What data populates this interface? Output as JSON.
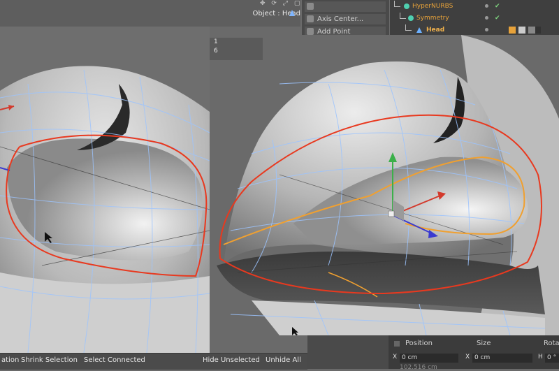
{
  "viewport": {
    "object_label": "Object : Head",
    "coords": [
      "1",
      "6"
    ]
  },
  "tool_menu": {
    "items": [
      {
        "label": "",
        "icon": "tool-icon"
      },
      {
        "label": "Axis Center...",
        "icon": "axis-center-icon"
      },
      {
        "label": "Add Point",
        "icon": "add-point-icon"
      }
    ]
  },
  "object_manager": {
    "rows": [
      {
        "name": "HyperNURBS",
        "icon": "hypernurbs-icon"
      },
      {
        "name": "Symmetry",
        "icon": "symmetry-icon"
      },
      {
        "name": "Head",
        "icon": "polygon-object-icon"
      }
    ]
  },
  "bottom_bar": {
    "items": [
      "ation",
      "Shrink Selection",
      "Select Connected",
      "Hide Unselected",
      "Unhide All"
    ]
  },
  "attributes": {
    "headers": [
      "Position",
      "Size",
      "Rota"
    ],
    "fields": [
      {
        "axis": "X",
        "value": "0 cm"
      },
      {
        "axis": "X",
        "value": "0 cm"
      },
      {
        "axis": "H",
        "value": "0 °"
      }
    ],
    "faded_row": "102.516 cm"
  },
  "colors": {
    "annotation": "#e8391f",
    "axis_y": "#3bb04a",
    "axis_x": "#d33a2c",
    "axis_z": "#3a3ad0",
    "wireframe": "#9cc4ff",
    "selected_edge": "#f0a030"
  }
}
